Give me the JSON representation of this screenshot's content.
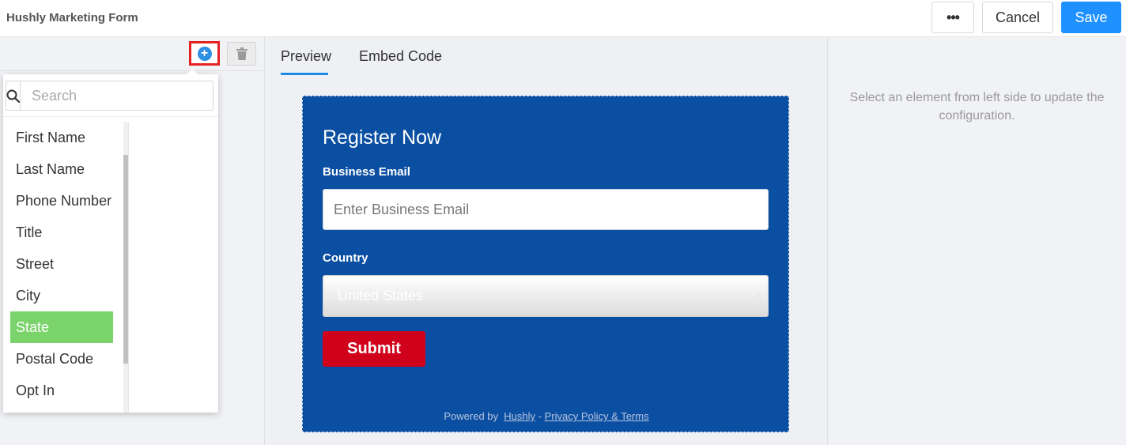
{
  "header": {
    "title": "Hushly Marketing Form",
    "more_label": "•••",
    "cancel_label": "Cancel",
    "save_label": "Save"
  },
  "left": {
    "search_placeholder": "Search",
    "fields": [
      "First Name",
      "Last Name",
      "Phone Number",
      "Title",
      "Street",
      "City",
      "State",
      "Postal Code",
      "Opt In"
    ],
    "selected_field": "State"
  },
  "center": {
    "tabs": [
      "Preview",
      "Embed Code"
    ],
    "active_tab": "Preview",
    "form": {
      "title": "Register Now",
      "email_label": "Business Email",
      "email_placeholder": "Enter Business Email",
      "country_label": "Country",
      "country_value": "United States",
      "submit_label": "Submit",
      "powered_by": "Powered by",
      "brand_link": "Hushly",
      "separator": "-",
      "privacy_link": "Privacy Policy & Terms"
    }
  },
  "right": {
    "message": "Select an element from left side to update the configuration."
  },
  "colors": {
    "accent": "#1e90ff",
    "form_bg": "#0b4fa3",
    "submit_bg": "#d0021b",
    "selected_item": "#7ad46b",
    "highlight_box": "#e52222"
  }
}
